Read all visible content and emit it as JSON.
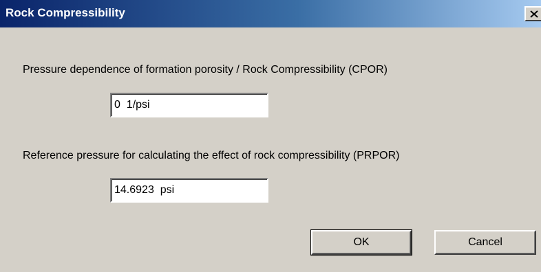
{
  "window": {
    "title": "Rock Compressibility",
    "close_icon": "close-icon"
  },
  "cpor": {
    "label": "Pressure dependence of formation porosity / Rock Compressibility (CPOR)",
    "value": "0  1/psi"
  },
  "prpor": {
    "label": "Reference pressure for calculating the effect of rock compressibility (PRPOR)",
    "value": "14.6923  psi"
  },
  "buttons": {
    "ok": "OK",
    "cancel": "Cancel"
  }
}
